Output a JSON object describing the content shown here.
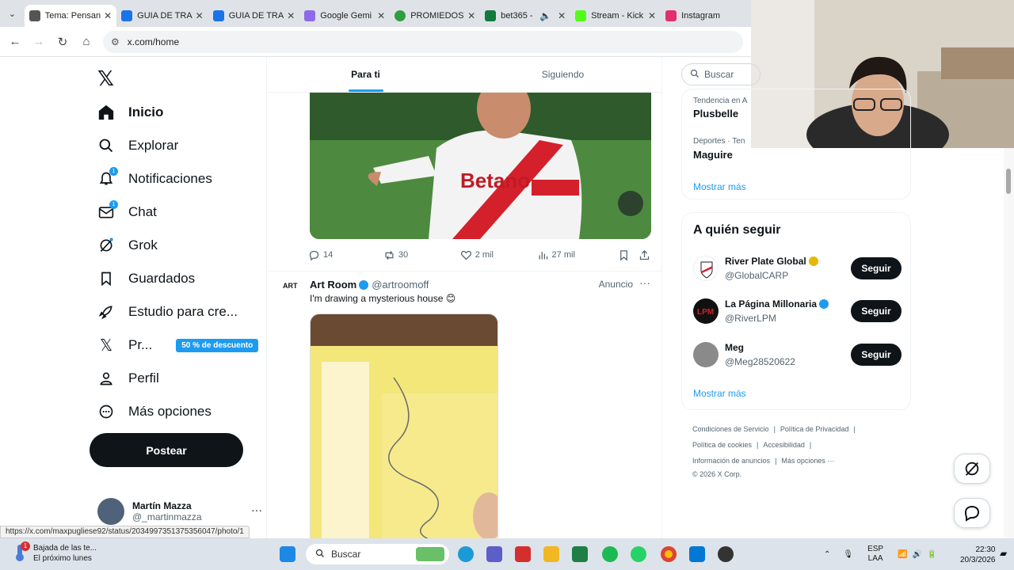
{
  "browser": {
    "tabs": [
      {
        "label": "Tema: Pensan",
        "color": "#555555"
      },
      {
        "label": "GUIA DE TRA",
        "color": "#1a73e8"
      },
      {
        "label": "GUIA DE TRA",
        "color": "#1a73e8"
      },
      {
        "label": "Google Gemi",
        "color": "#8e6ae8"
      },
      {
        "label": "PROMIEDOS",
        "color": "#2e9e3f"
      },
      {
        "label": "bet365 -",
        "color": "#127a3c"
      },
      {
        "label": "Stream - Kick",
        "color": "#53fc18"
      },
      {
        "label": "Instagram",
        "color": "#e1306c"
      }
    ],
    "url": "x.com/home",
    "status_url": "https://x.com/maxpugliese92/status/2034997351375356047/photo/1"
  },
  "leftnav": {
    "items": [
      {
        "label": "Inicio",
        "icon": "home-icon",
        "badge": ""
      },
      {
        "label": "Explorar",
        "icon": "search-icon",
        "badge": ""
      },
      {
        "label": "Notificaciones",
        "icon": "bell-icon",
        "badge": "1"
      },
      {
        "label": "Chat",
        "icon": "mail-icon",
        "badge": "1"
      },
      {
        "label": "Grok",
        "icon": "grok-icon",
        "badge": ""
      },
      {
        "label": "Guardados",
        "icon": "bookmark-icon",
        "badge": ""
      },
      {
        "label": "Estudio para cre...",
        "icon": "rocket-icon",
        "badge": ""
      },
      {
        "label": "Pr...",
        "icon": "x-premium-icon",
        "badge": ""
      },
      {
        "label": "Perfil",
        "icon": "person-icon",
        "badge": ""
      },
      {
        "label": "Más opciones",
        "icon": "more-circle-icon",
        "badge": ""
      }
    ],
    "promo": "50 % de descuento",
    "post_label": "Postear",
    "user": {
      "name": "Martín Mazza",
      "handle": "@_martinmazza"
    }
  },
  "timeline": {
    "tabs": [
      "Para ti",
      "Siguiendo"
    ],
    "tweet1": {
      "replies": "14",
      "reposts": "30",
      "likes": "2 mil",
      "views": "27 mil"
    },
    "tweet2": {
      "avatar_text": "ART",
      "name": "Art Room",
      "handle": "@artroomoff",
      "ad": "Anuncio",
      "text": "I'm drawing a mysterious house 😊"
    }
  },
  "rightcol": {
    "search_placeholder": "Buscar",
    "trends": [
      {
        "context": "Tendencia en A",
        "name": "Plusbelle"
      },
      {
        "context": "Deportes · Ten",
        "name": "Maguire"
      }
    ],
    "show_more": "Mostrar más",
    "who_to_follow_title": "A quién seguir",
    "follow": [
      {
        "name": "River Plate Global",
        "handle": "@GlobalCARP",
        "btn": "Seguir",
        "color": "#ffffff"
      },
      {
        "name": "La Página Millonaria",
        "handle": "@RiverLPM",
        "btn": "Seguir",
        "color": "#111111"
      },
      {
        "name": "Meg",
        "handle": "@Meg28520622",
        "btn": "Seguir",
        "color": "#8a8a8a"
      }
    ],
    "show_more2": "Mostrar más",
    "footer": {
      "l1a": "Condiciones de Servicio",
      "l1b": "Política de Privacidad",
      "l2a": "Política de cookies",
      "l2b": "Accesibilidad",
      "l3a": "Información de anuncios",
      "l3b": "Más opciones ···",
      "copy": "© 2026 X Corp."
    }
  },
  "taskbar": {
    "weather_line1": "Bajada de las te...",
    "weather_line2": "El próximo lunes",
    "weather_badge": "1",
    "search": "Buscar",
    "lang1": "ESP",
    "lang2": "LAA",
    "time": "22:30",
    "date": "20/3/2026"
  },
  "colors": {
    "accent": "#1d9bf0",
    "river_red": "#d4202b"
  }
}
